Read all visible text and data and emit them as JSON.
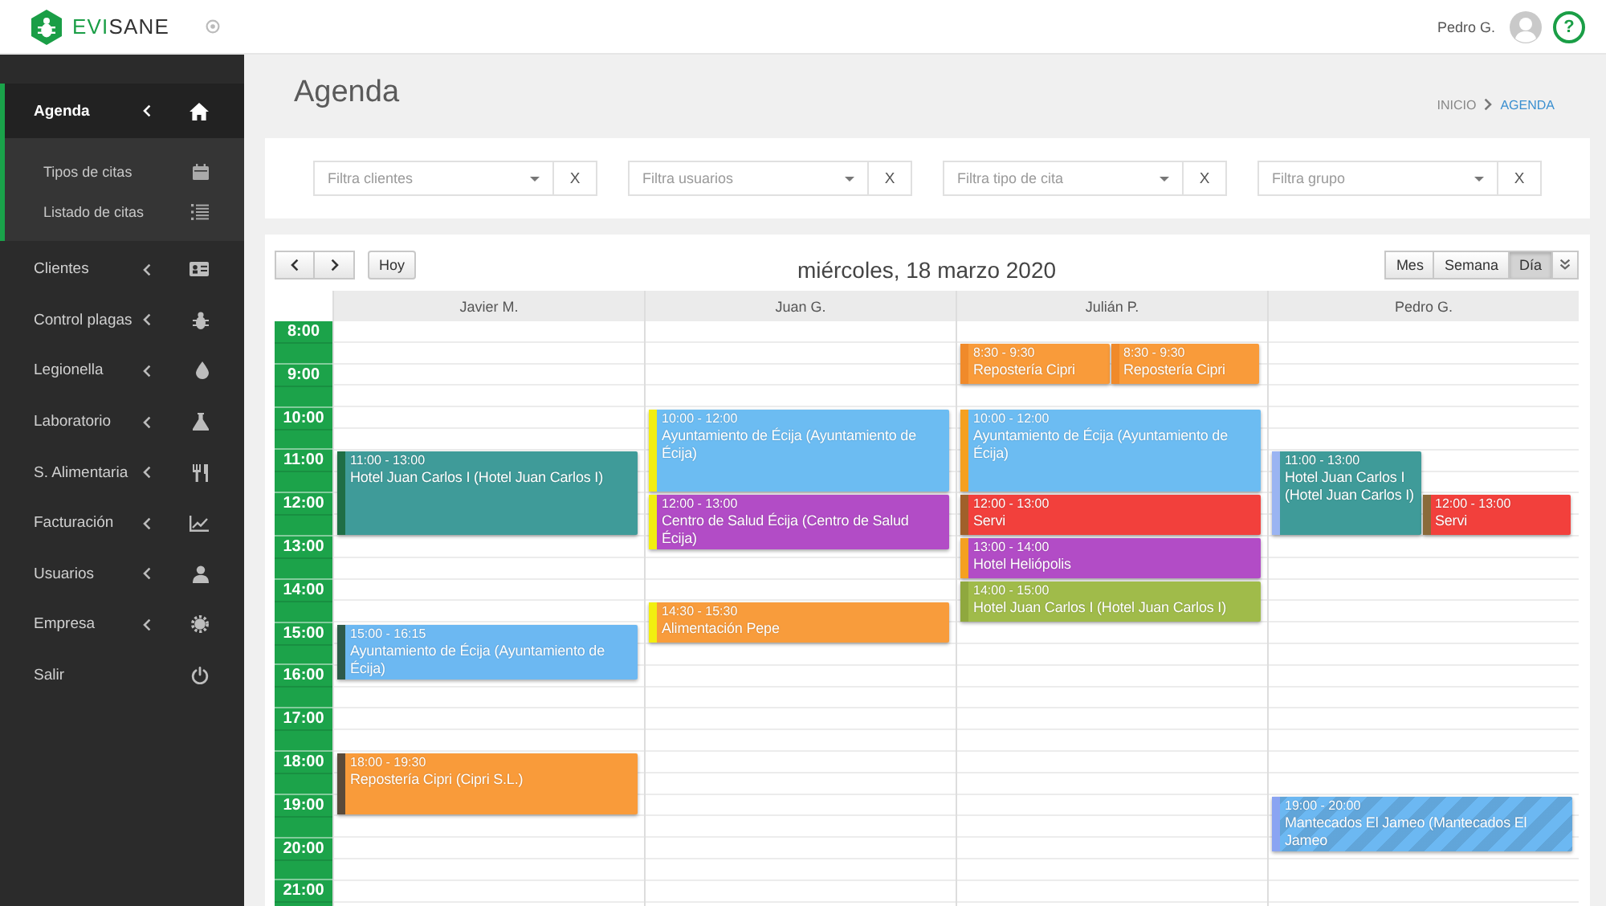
{
  "topbar": {
    "logo": {
      "accent": "EVI",
      "rest": "SANE"
    },
    "user_name": "Pedro G.",
    "help": "?"
  },
  "sidebar": {
    "items": [
      {
        "label": "Agenda",
        "kind": "group",
        "selected": true,
        "children": [
          {
            "label": "Tipos de citas"
          },
          {
            "label": "Listado de citas"
          }
        ]
      },
      {
        "label": "Clientes",
        "kind": "group",
        "selected": false
      },
      {
        "label": "Control plagas",
        "kind": "group",
        "selected": false
      },
      {
        "label": "Legionella",
        "kind": "group",
        "selected": false
      },
      {
        "label": "Laboratorio",
        "kind": "group",
        "selected": false
      },
      {
        "label": "S. Alimentaria",
        "kind": "group",
        "selected": false
      },
      {
        "label": "Facturación",
        "kind": "group",
        "selected": false
      },
      {
        "label": "Usuarios",
        "kind": "group",
        "selected": false
      },
      {
        "label": "Empresa",
        "kind": "group",
        "selected": false
      },
      {
        "label": "Salir",
        "kind": "link",
        "selected": false
      }
    ]
  },
  "page": {
    "title": "Agenda",
    "breadcrumb": [
      {
        "label": "INICIO",
        "selected": false
      },
      {
        "label": "AGENDA",
        "selected": true
      }
    ]
  },
  "filters": [
    {
      "placeholder": "Filtra clientes",
      "clear": "X"
    },
    {
      "placeholder": "Filtra usuarios",
      "clear": "X"
    },
    {
      "placeholder": "Filtra tipo de cita",
      "clear": "X"
    },
    {
      "placeholder": "Filtra grupo",
      "clear": "X"
    }
  ],
  "calendar": {
    "today_button": "Hoy",
    "title": "miércoles, 18 marzo 2020",
    "views": [
      {
        "label": "Mes",
        "selected": false
      },
      {
        "label": "Semana",
        "selected": false
      },
      {
        "label": "Día",
        "selected": true
      }
    ],
    "hours": [
      "8:00",
      "9:00",
      "10:00",
      "11:00",
      "12:00",
      "13:00",
      "14:00",
      "15:00",
      "16:00",
      "17:00",
      "18:00",
      "19:00",
      "20:00",
      "21:00"
    ],
    "resources": [
      {
        "name": "Javier M.",
        "events": [
          {
            "time": "11:00 - 13:00",
            "title": "Hotel Juan Carlos I (Hotel Juan Carlos I)",
            "color": "#3f9b99",
            "stripe": {
              "color": "#1f6e45"
            },
            "striped": false
          },
          {
            "time": "15:00 - 16:15",
            "title": "Ayuntamiento de Écija (Ayuntamiento de Écija)",
            "color": "#6cb8f2",
            "stripe": {
              "color": "#2e5a4a"
            },
            "striped": false
          },
          {
            "time": "18:00 - 19:30",
            "title": "Repostería Cipri (Cipri S.L.)",
            "color": "#f99b3a",
            "stripe": {
              "color": "#5a4a3a"
            },
            "striped": false
          }
        ]
      },
      {
        "name": "Juan G.",
        "events": [
          {
            "time": "10:00 - 12:00",
            "title": "Ayuntamiento de Écija (Ayuntamiento de Écija)",
            "color": "#6cbcf2",
            "stripe": {
              "color": "#f2ee10"
            },
            "striped": false
          },
          {
            "time": "12:00 - 13:00",
            "title": "Centro de Salud Écija (Centro de Salud Écija)",
            "color": "#b24cc6",
            "stripe": {
              "color": "#f2ee10"
            },
            "striped": false
          },
          {
            "time": "14:30 - 15:30",
            "title": "Alimentación Pepe",
            "color": "#f89c3c",
            "stripe": {
              "color": "#f2ee10"
            },
            "striped": false
          }
        ]
      },
      {
        "name": "Julián P.",
        "events": [
          {
            "time": "8:30 - 9:30",
            "title": "Repostería Cipri",
            "color": "#f99b3a",
            "stripe": {
              "color": "#f08a2a"
            },
            "striped": false
          },
          {
            "time": "8:30 - 9:30",
            "title": "Repostería Cipri",
            "color": "#f99b3a",
            "stripe": {
              "color": "#f08a2a"
            },
            "striped": false
          },
          {
            "time": "10:00 - 12:00",
            "title": "Ayuntamiento de Écija (Ayuntamiento de Écija)",
            "color": "#6cbcf2",
            "stripe": {
              "color": "#f5a020"
            },
            "striped": false
          },
          {
            "time": "12:00 - 13:00",
            "title": "Servi",
            "color": "#f2403c",
            "stripe": {
              "color": "#a0602a"
            },
            "striped": false
          },
          {
            "time": "13:00 - 14:00",
            "title": "Hotel Heliópolis",
            "color": "#b24cc6",
            "stripe": {
              "color": "#f5a020"
            },
            "striped": false
          },
          {
            "time": "14:00 - 15:00",
            "title": "Hotel Juan Carlos I (Hotel Juan Carlos I)",
            "color": "#a0bb4a",
            "stripe": {
              "color": "#8fa83e"
            },
            "striped": false
          }
        ]
      },
      {
        "name": "Pedro G.",
        "events": [
          {
            "time": "11:00 - 13:00",
            "title": "Hotel Juan Carlos I (Hotel Juan Carlos I)",
            "color": "#3f9b99",
            "stripe": {
              "color": "#9ab4f2"
            },
            "striped": false
          },
          {
            "time": "12:00 - 13:00",
            "title": "Servi",
            "color": "#f2403c",
            "stripe": {
              "color": "#8a6a3a"
            },
            "striped": false
          },
          {
            "time": "19:00 - 20:00",
            "title": "Mantecados El Jameo (Mantecados El Jameo",
            "color": "#6cb8f2",
            "stripe": {
              "color": "#8aa4f2"
            },
            "striped": true
          }
        ]
      }
    ]
  }
}
